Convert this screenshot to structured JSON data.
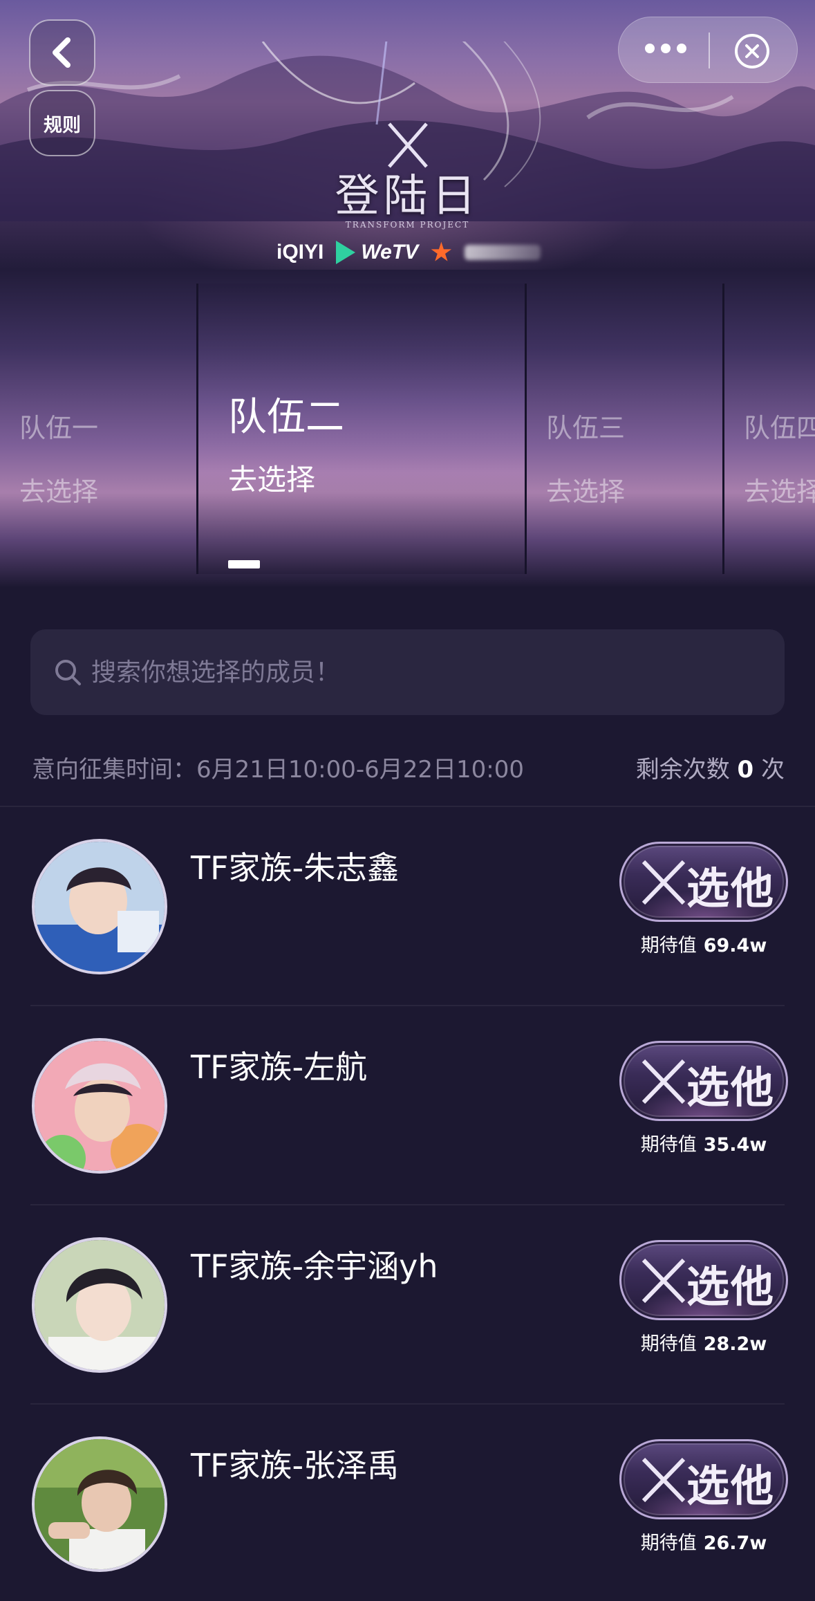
{
  "header": {
    "rules_label": "规则",
    "logo_title": "登陆日",
    "logo_subtitle": "TRANSFORM PROJECT",
    "sponsors": [
      "iQIYI",
      "WeTV"
    ]
  },
  "teams": [
    {
      "name": "队伍一",
      "action": "去选择",
      "selected": false
    },
    {
      "name": "队伍二",
      "action": "去选择",
      "selected": true
    },
    {
      "name": "队伍三",
      "action": "去选择",
      "selected": false
    },
    {
      "name": "队伍四",
      "action": "去选择",
      "selected": false
    }
  ],
  "search": {
    "placeholder": "搜索你想选择的成员！"
  },
  "info": {
    "time_label": "意向征集时间：6月21日10:00-6月22日10:00",
    "remaining_prefix": "剩余次数",
    "remaining_count": "0",
    "remaining_suffix": "次"
  },
  "members": [
    {
      "name": "TF家族-朱志鑫",
      "button": "选他",
      "expect_label": "期待值",
      "expect_value": "69.4w"
    },
    {
      "name": "TF家族-左航",
      "button": "选他",
      "expect_label": "期待值",
      "expect_value": "35.4w"
    },
    {
      "name": "TF家族-余宇涵yh",
      "button": "选他",
      "expect_label": "期待值",
      "expect_value": "28.2w"
    },
    {
      "name": "TF家族-张泽禹",
      "button": "选他",
      "expect_label": "期待值",
      "expect_value": "26.7w"
    }
  ]
}
